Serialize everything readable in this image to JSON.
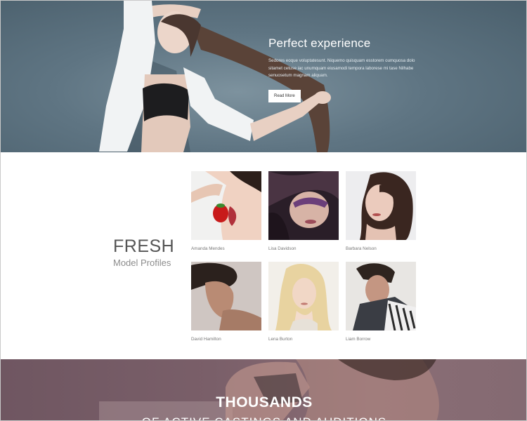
{
  "hero": {
    "title": "Perfect experience",
    "text": "Sedores eoque voluptatesunt. Niquemo quisquam esstorem oumquosa dolo sitamet cetuse iac unumquam eiusamodi tempora laborese mi tase Nilhabe senuosetum magnam aliquam.",
    "button_label": "Read More"
  },
  "profiles_section": {
    "heading_big": "FRESH",
    "heading_small": "Model Profiles",
    "models": [
      {
        "name": "Amanda Mendes"
      },
      {
        "name": "Lisa Davidson"
      },
      {
        "name": "Barbara Nelson"
      },
      {
        "name": "David Hamilton"
      },
      {
        "name": "Lena Burton"
      },
      {
        "name": "Liam Borrow"
      }
    ]
  },
  "banner": {
    "title": "THOUSANDS",
    "subtitle": "OF ACTIVE CASTINGS AND AUDITIONS"
  }
}
